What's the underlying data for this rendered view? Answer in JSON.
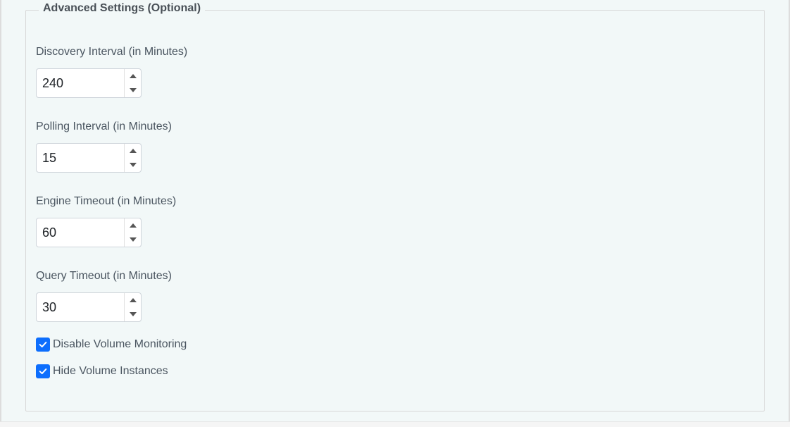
{
  "fieldset": {
    "legend": "Advanced Settings (Optional)",
    "fields": {
      "discovery_interval": {
        "label": "Discovery Interval (in Minutes)",
        "value": "240"
      },
      "polling_interval": {
        "label": "Polling Interval (in Minutes)",
        "value": "15"
      },
      "engine_timeout": {
        "label": "Engine Timeout (in Minutes)",
        "value": "60"
      },
      "query_timeout": {
        "label": "Query Timeout (in Minutes)",
        "value": "30"
      }
    },
    "checkboxes": {
      "disable_volume_monitoring": {
        "label": "Disable Volume Monitoring",
        "checked": true
      },
      "hide_volume_instances": {
        "label": "Hide Volume Instances",
        "checked": true
      }
    }
  }
}
